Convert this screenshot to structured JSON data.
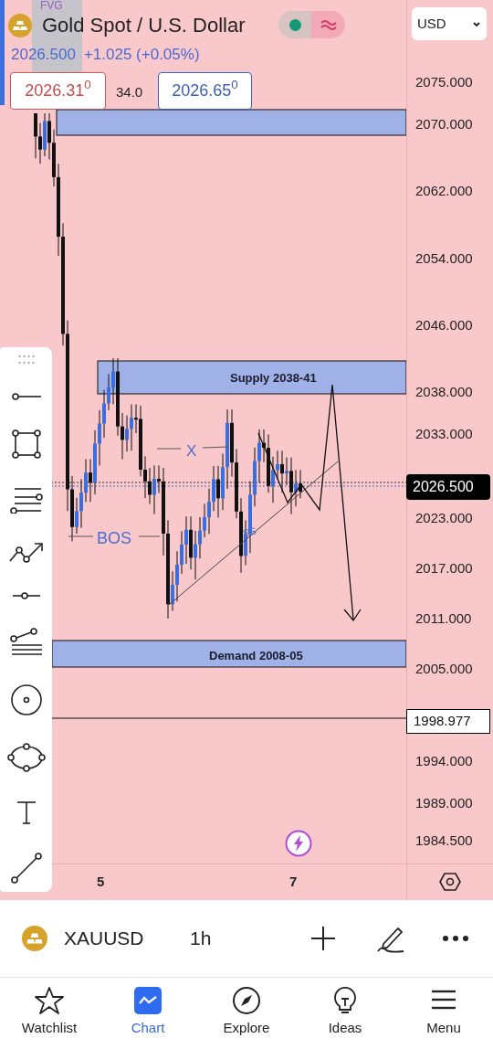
{
  "header": {
    "title": "Gold Spot / U.S. Dollar",
    "price": "2026.500",
    "change": "+1.025 (+0.05%)",
    "bid": "2026.31$^{0}$",
    "spread": "34.0",
    "ask": "2026.65$^{0}$",
    "currency": "USD"
  },
  "chart": {
    "fvg": "FVG",
    "supply": "Supply 2038-41",
    "demand": "Demand 2008-05",
    "bos": "BOS",
    "x_label": "X",
    "ss": "SS",
    "price_axis": [
      "2075.000",
      "2070.000",
      "2062.000",
      "2054.000",
      "2046.000",
      "2038.000",
      "2033.000",
      "2023.000",
      "2017.000",
      "2011.000",
      "2005.000",
      "1994.000",
      "1989.000",
      "1984.500"
    ],
    "current_price": "2026.500",
    "marked_price": "1998.977",
    "time_axis": [
      "5",
      "7"
    ]
  },
  "symbol_bar": {
    "symbol": "XAUUSD",
    "interval": "1h"
  },
  "nav": [
    {
      "label": "Watchlist",
      "selected": false
    },
    {
      "label": "Chart",
      "selected": true
    },
    {
      "label": "Explore",
      "selected": false
    },
    {
      "label": "Ideas",
      "selected": false
    },
    {
      "label": "Menu",
      "selected": false
    }
  ]
}
